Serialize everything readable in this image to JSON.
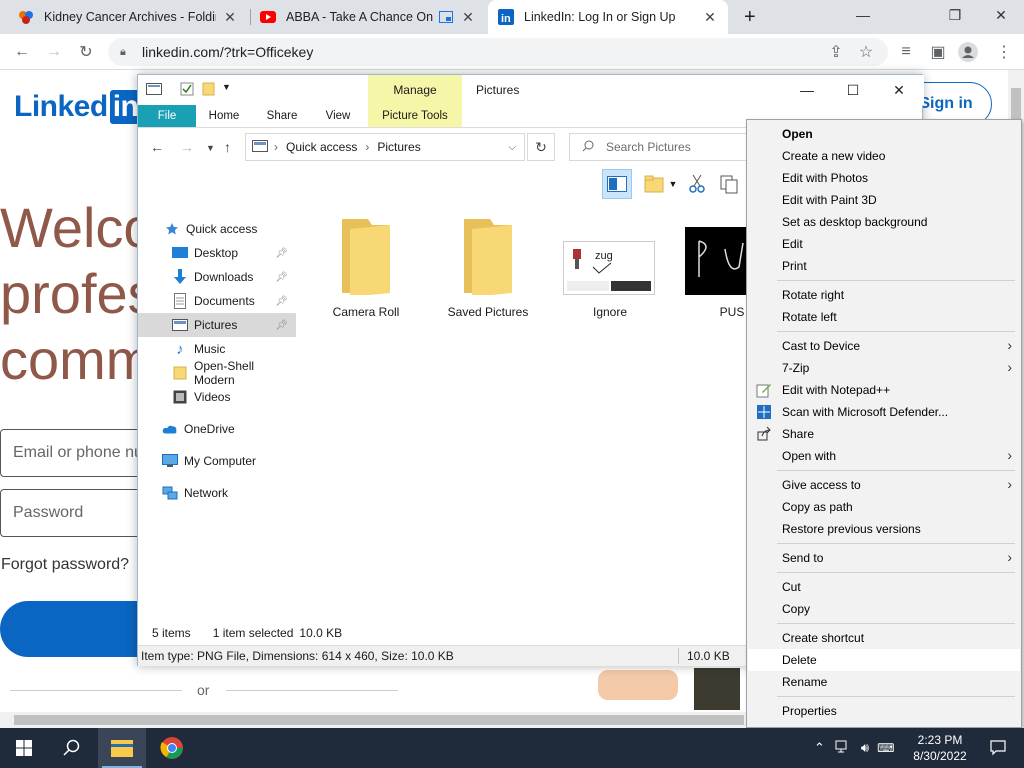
{
  "browser": {
    "tabs": [
      {
        "title": "Kidney Cancer Archives - Folding",
        "close": "✕"
      },
      {
        "title": "ABBA - Take A Chance On M",
        "close": "✕"
      },
      {
        "title": "LinkedIn: Log In or Sign Up",
        "close": "✕"
      }
    ],
    "new_tab": "+",
    "url": "linkedin.com/?trk=Officekey"
  },
  "linkedin": {
    "logo_text": "Linked",
    "logo_box": "in",
    "headline": [
      "Welco",
      "profes",
      "comm"
    ],
    "email_placeholder": "Email or phone nu",
    "password_placeholder": "Password",
    "forgot": "Forgot password?",
    "signin": "Sign in",
    "or": "or"
  },
  "explorer": {
    "title": "Pictures",
    "manage": "Manage",
    "ribbon_tabs": [
      "File",
      "Home",
      "Share",
      "View",
      "Picture Tools"
    ],
    "breadcrumb": [
      "Quick access",
      "Pictures"
    ],
    "search_placeholder": "Search Pictures",
    "nav": [
      {
        "label": "Quick access",
        "icon": "star-icon"
      },
      {
        "label": "Desktop",
        "icon": "desktop-icon",
        "pinned": true
      },
      {
        "label": "Downloads",
        "icon": "download-icon",
        "pinned": true
      },
      {
        "label": "Documents",
        "icon": "documents-icon",
        "pinned": true
      },
      {
        "label": "Pictures",
        "icon": "pictures-icon",
        "pinned": true,
        "selected": true
      },
      {
        "label": "Music",
        "icon": "music-icon"
      },
      {
        "label": "Open-Shell Modern",
        "icon": "folder-icon"
      },
      {
        "label": "Videos",
        "icon": "videos-icon"
      },
      {
        "label": "OneDrive",
        "icon": "cloud-icon"
      },
      {
        "label": "My Computer",
        "icon": "computer-icon"
      },
      {
        "label": "Network",
        "icon": "network-icon"
      }
    ],
    "files": [
      {
        "name": "Camera Roll",
        "kind": "folder"
      },
      {
        "name": "Saved Pictures",
        "kind": "folder"
      },
      {
        "name": "Ignore",
        "kind": "image-ignore"
      },
      {
        "name": "PUS",
        "kind": "image-pus"
      }
    ],
    "status": {
      "count": "5 items",
      "selected": "1 item selected",
      "size": "10.0 KB"
    },
    "details": {
      "info": "Item type: PNG File, Dimensions: 614 x 460, Size: 10.0 KB",
      "size": "10.0 KB"
    }
  },
  "context_menu": [
    {
      "label": "Open",
      "bold": true
    },
    {
      "label": "Create a new video"
    },
    {
      "label": "Edit with Photos"
    },
    {
      "label": "Edit with Paint 3D"
    },
    {
      "label": "Set as desktop background"
    },
    {
      "label": "Edit"
    },
    {
      "label": "Print"
    },
    {
      "sep": true
    },
    {
      "label": "Rotate right"
    },
    {
      "label": "Rotate left"
    },
    {
      "sep": true
    },
    {
      "label": "Cast to Device",
      "sub": true
    },
    {
      "label": "7-Zip",
      "sub": true
    },
    {
      "label": "Edit with Notepad++",
      "icon": "notepadpp-icon"
    },
    {
      "label": "Scan with Microsoft Defender...",
      "icon": "defender-icon"
    },
    {
      "label": "Share",
      "icon": "share-icon"
    },
    {
      "label": "Open with",
      "sub": true
    },
    {
      "sep": true
    },
    {
      "label": "Give access to",
      "sub": true
    },
    {
      "label": "Copy as path"
    },
    {
      "label": "Restore previous versions"
    },
    {
      "sep": true
    },
    {
      "label": "Send to",
      "sub": true
    },
    {
      "sep": true
    },
    {
      "label": "Cut"
    },
    {
      "label": "Copy"
    },
    {
      "sep": true
    },
    {
      "label": "Create shortcut"
    },
    {
      "label": "Delete",
      "hover": true
    },
    {
      "label": "Rename"
    },
    {
      "sep": true
    },
    {
      "label": "Properties"
    }
  ],
  "taskbar": {
    "time": "2:23 PM",
    "date": "8/30/2022"
  },
  "colors": {
    "linkedin_blue": "#0a66c2",
    "file_tab": "#1aa0b4",
    "manage_tab": "#f6f6a8",
    "taskbar": "#1f2a3a"
  }
}
